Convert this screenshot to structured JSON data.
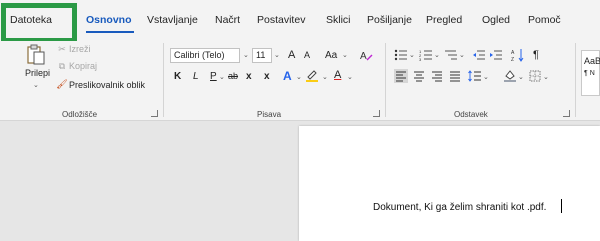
{
  "menu": {
    "tabs": [
      {
        "label": "Datoteka",
        "active": false
      },
      {
        "label": "Osnovno",
        "active": true
      },
      {
        "label": "Vstavljanje",
        "active": false
      },
      {
        "label": "Načrt",
        "active": false
      },
      {
        "label": "Postavitev",
        "active": false
      },
      {
        "label": "Sklici",
        "active": false
      },
      {
        "label": "Pošiljanje",
        "active": false
      },
      {
        "label": "Pregled",
        "active": false
      },
      {
        "label": "Ogled",
        "active": false
      },
      {
        "label": "Pomoč",
        "active": false
      }
    ],
    "highlight_color": "#2b9a46",
    "accent_color": "#185abd"
  },
  "clipboard": {
    "paste_label": "Prilepi",
    "cut_label": "Izreži",
    "copy_label": "Kopiraj",
    "format_painter_label": "Preslikovalnik oblik",
    "group_label": "Odložišče"
  },
  "font": {
    "font_name": "Calibri (Telo)",
    "font_size": "11",
    "grow_label": "A",
    "shrink_label": "A",
    "case_label": "Aa",
    "bold": "K",
    "italic": "L",
    "underline": "P",
    "strike": "ab",
    "subscript": "x",
    "superscript": "x",
    "effects": "A",
    "highlight": "ab",
    "font_color": "A",
    "group_label": "Pisava"
  },
  "paragraph": {
    "group_label": "Odstavek"
  },
  "styles": {
    "preview_text": "AaB",
    "normal_label": "¶ N"
  },
  "document": {
    "text": "Dokument, Ki ga želim shraniti kot .pdf."
  }
}
